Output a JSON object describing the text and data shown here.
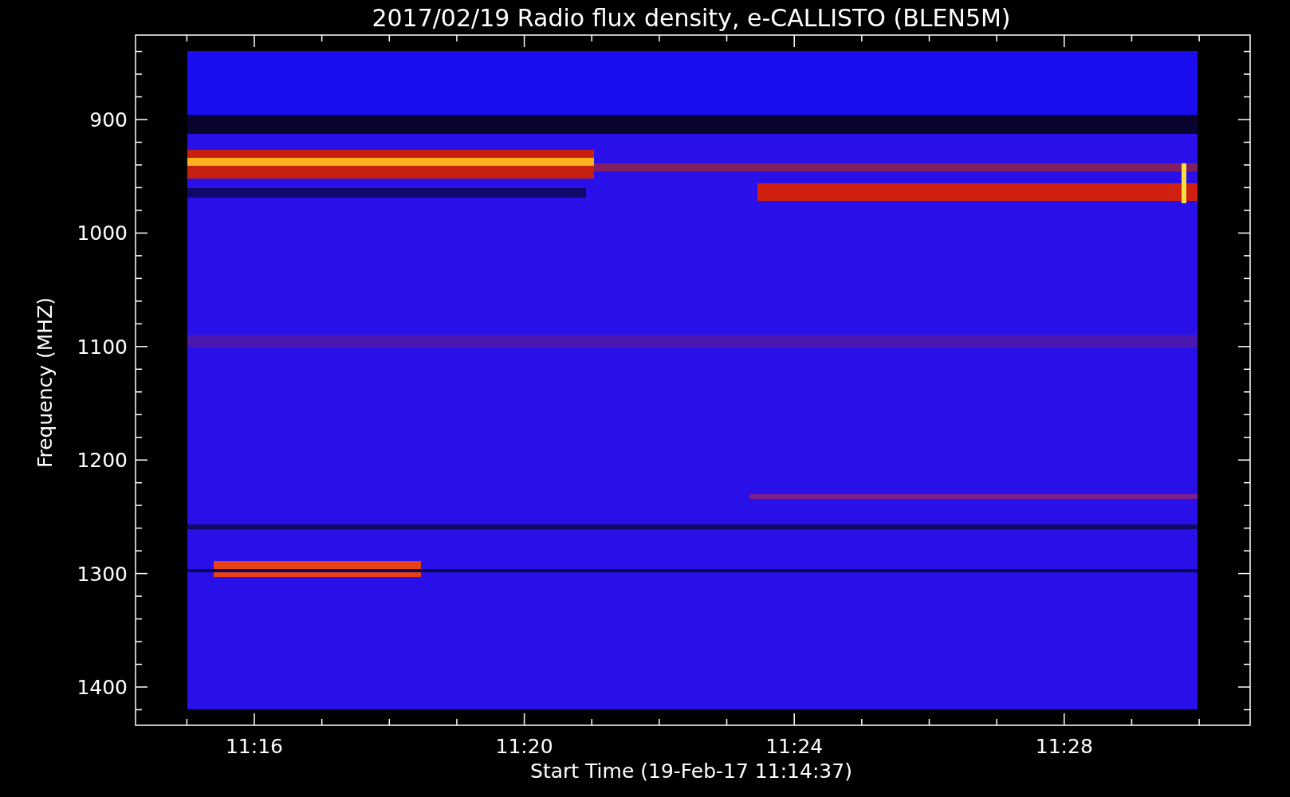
{
  "title": "2017/02/19  Radio flux density, e-CALLISTO (BLEN5M)",
  "y_axis": {
    "label": "Frequency (MHZ)",
    "ticks": [
      "900",
      "1000",
      "1100",
      "1200",
      "1300",
      "1400"
    ]
  },
  "x_axis": {
    "label": "Start Time (19-Feb-17 11:14:37)",
    "ticks": [
      "11:16",
      "11:20",
      "11:24",
      "11:28"
    ]
  }
}
